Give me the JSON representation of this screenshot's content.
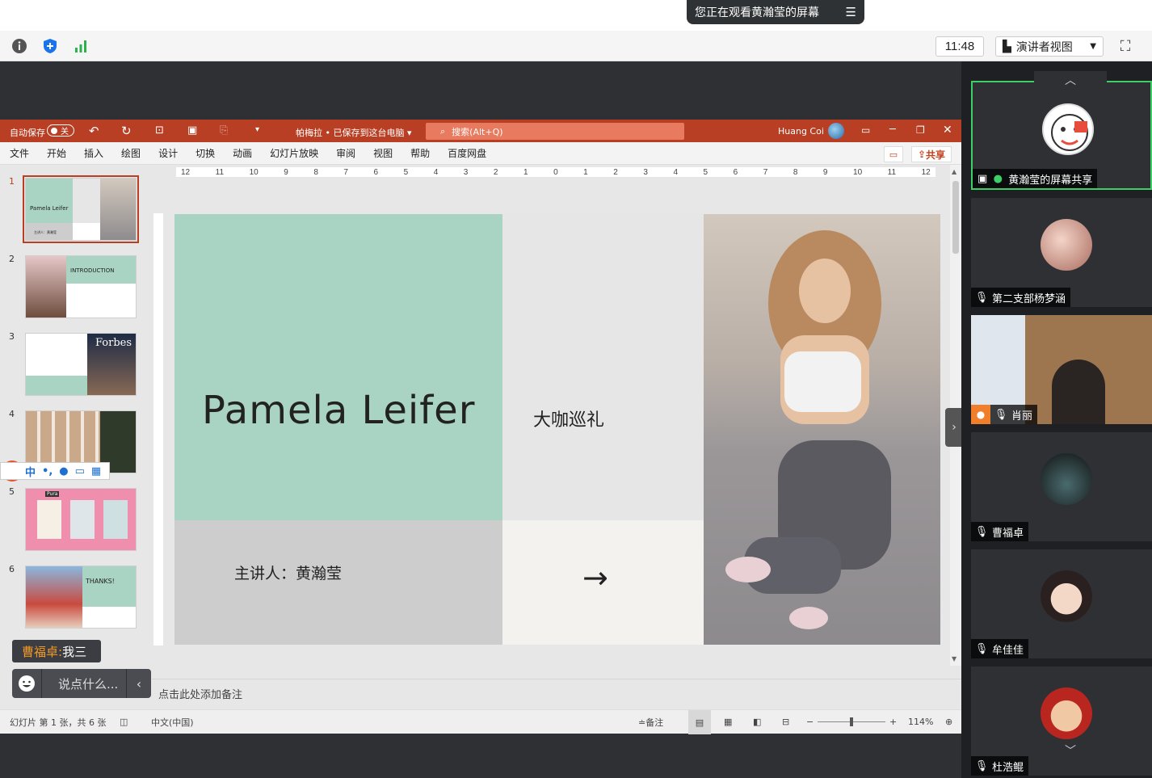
{
  "banner": {
    "text": "您正在观看黄瀚莹的屏幕",
    "menu_icon": "list-icon"
  },
  "meeting_toolbar": {
    "time": "11:48",
    "view_label": "演讲者视图",
    "icons": [
      "info-icon",
      "shield-icon",
      "signal-icon",
      "fullscreen-icon"
    ]
  },
  "ppt": {
    "autosave_label": "自动保存",
    "autosave_state": "关",
    "file_title": "帕梅拉 • 已保存到这台电脑",
    "search_placeholder": "搜索(Alt+Q)",
    "user_name": "Huang Coi",
    "menu": [
      "文件",
      "开始",
      "插入",
      "绘图",
      "设计",
      "切换",
      "动画",
      "幻灯片放映",
      "审阅",
      "视图",
      "帮助",
      "百度网盘"
    ],
    "share_label": "共享",
    "ruler_ticks": [
      "12",
      "11",
      "10",
      "9",
      "8",
      "7",
      "6",
      "5",
      "4",
      "3",
      "2",
      "1",
      "0",
      "1",
      "2",
      "3",
      "4",
      "5",
      "6",
      "7",
      "8",
      "9",
      "10",
      "11",
      "12"
    ],
    "thumbnails": [
      {
        "num": "1",
        "title": "Pamela Leifer",
        "sub": "主讲人：黄瀚莹"
      },
      {
        "num": "2",
        "title": "INTRODUCTION",
        "sub": ""
      },
      {
        "num": "3",
        "title": "Forbes",
        "sub": ""
      },
      {
        "num": "4",
        "title": "",
        "sub": ""
      },
      {
        "num": "5",
        "title": "Pura",
        "sub": ""
      },
      {
        "num": "6",
        "title": "THANKS!",
        "sub": ""
      }
    ],
    "slide": {
      "title": "Pamela Leifer",
      "subtitle": "大咖巡礼",
      "speaker": "主讲人：黄瀚莹",
      "arrow": "→"
    },
    "notes_placeholder": "点击此处添加备注",
    "status": {
      "slide_info": "幻灯片 第 1 张，共 6 张",
      "language": "中文(中国)",
      "notes_btn": "备注",
      "zoom": "114%"
    },
    "colors": {
      "accent": "#b83f24",
      "mint": "#a9d4c4"
    }
  },
  "ime": {
    "logo": "S",
    "items": [
      "中",
      "•,",
      "🎙",
      "⌨",
      "▦"
    ]
  },
  "chat": {
    "last_sender": "曹福卓:",
    "last_message": "我三",
    "input_placeholder": "说点什么..."
  },
  "participants": [
    {
      "name": "黄瀚莹的屏幕共享",
      "muted": false,
      "active": true
    },
    {
      "name": "第二支部杨梦涵",
      "muted": true,
      "active": false
    },
    {
      "name": "肖丽",
      "muted": true,
      "active": false
    },
    {
      "name": "曹福卓",
      "muted": true,
      "active": false
    },
    {
      "name": "牟佳佳",
      "muted": true,
      "active": false
    },
    {
      "name": "杜浩鲲",
      "muted": true,
      "active": false
    }
  ]
}
